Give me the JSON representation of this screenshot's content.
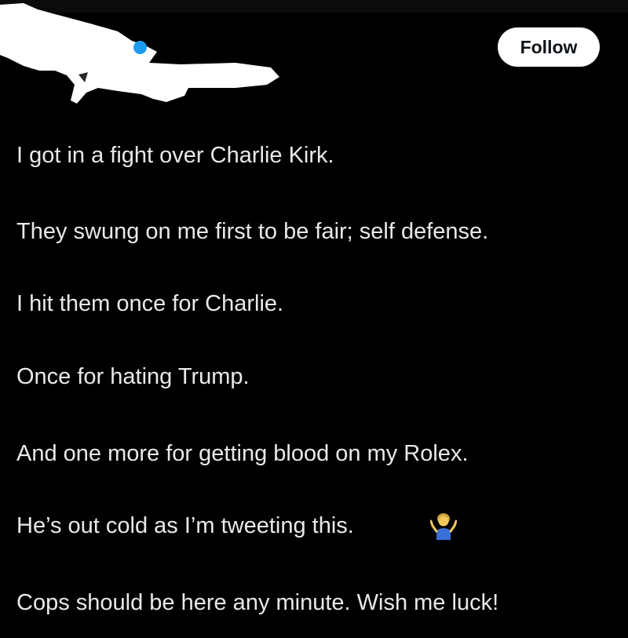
{
  "header": {
    "follow_label": "Follow"
  },
  "tweet": {
    "lines": [
      "I got in a fight over Charlie Kirk.",
      "They swung on me first to be fair; self defense.",
      "I hit them once for Charlie.",
      "Once for hating Trump.",
      "And one more for getting blood on my Rolex.",
      "He’s out cold as I’m tweeting this.",
      "Cops should be here any minute. Wish me luck!"
    ],
    "emoji": "person-shrugging-icon"
  },
  "colors": {
    "background": "#000000",
    "text": "#e9e9e9",
    "follow_button_bg": "#ffffff",
    "follow_button_text": "#0f1419",
    "verified": "#1d9bf0",
    "redaction": "#ffffff"
  }
}
